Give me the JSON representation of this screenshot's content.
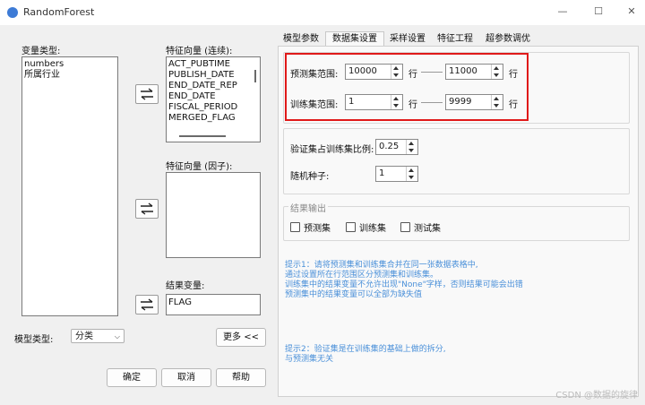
{
  "window": {
    "title": "RandomForest",
    "icons": [
      "app-icon",
      "minimize-icon",
      "maximize-icon",
      "close-icon"
    ]
  },
  "left": {
    "var_type_label": "变量类型:",
    "var_types": [
      "numbers",
      "所属行业"
    ],
    "feature_cont_label": "特征向量 (连续):",
    "feature_cont": [
      "ACT_PUBTIME",
      "PUBLISH_DATE",
      "END_DATE_REP",
      "END_DATE",
      "FISCAL_PERIOD",
      "MERGED_FLAG"
    ],
    "feature_factor_label": "特征向量 (因子):",
    "feature_factor": [],
    "result_var_label": "结果变量:",
    "result_var_value": "FLAG",
    "model_type_label": "模型类型:",
    "model_type_value": "分类",
    "more_label": "更多 <<",
    "ok_label": "确定",
    "cancel_label": "取消",
    "help_label": "帮助"
  },
  "tabs": [
    {
      "label": "模型参数",
      "active": false
    },
    {
      "label": "数据集设置",
      "active": true
    },
    {
      "label": "采样设置",
      "active": false
    },
    {
      "label": "特征工程",
      "active": false
    },
    {
      "label": "超参数调优",
      "active": false
    }
  ],
  "dataset": {
    "predict_label": "预测集范围:",
    "predict_from": "10000",
    "predict_to": "11000",
    "train_label": "训练集范围:",
    "train_from": "1",
    "train_to": "9999",
    "row_unit": "行",
    "val_ratio_label": "验证集占训练集比例:",
    "val_ratio": "0.25",
    "seed_label": "随机种子:",
    "seed": "1",
    "output_label": "结果输出",
    "out_predict": "预测集",
    "out_train": "训练集",
    "out_test": "测试集",
    "hint1": [
      "提示1：请将预测集和训练集合并在同一张数据表格中,",
      "通过设置所在行范围区分预测集和训练集。",
      "训练集中的结果变量不允许出现\"None\"字样，否则结果可能会出错",
      "预测集中的结果变量可以全部为缺失值"
    ],
    "hint2": [
      "提示2：验证集是在训练集的基础上做的拆分,",
      "与预测集无关"
    ]
  },
  "watermark": "CSDN @数据的旋律",
  "colors": {
    "highlight": "#e01919",
    "hint": "#4a90d9",
    "accent": "#3d7bd6"
  }
}
